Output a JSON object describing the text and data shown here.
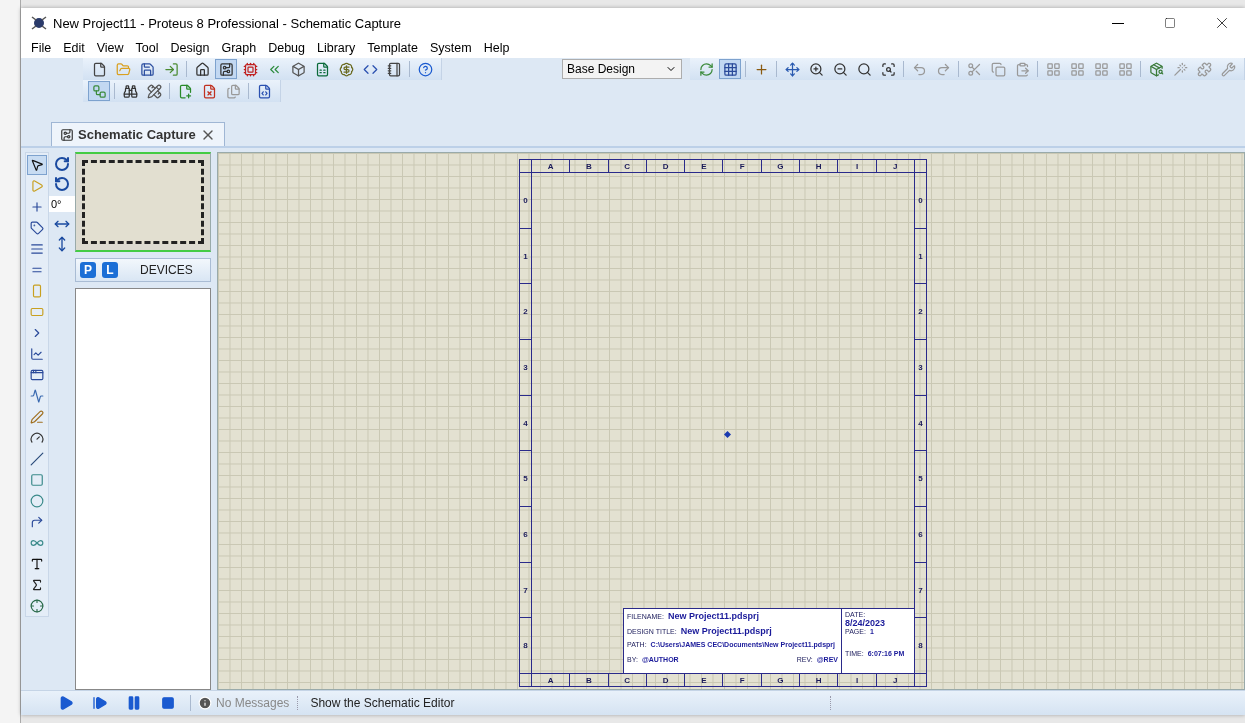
{
  "window": {
    "title": "New Project11 - Proteus 8 Professional - Schematic Capture"
  },
  "menu": [
    "File",
    "Edit",
    "View",
    "Tool",
    "Design",
    "Graph",
    "Debug",
    "Library",
    "Template",
    "System",
    "Help"
  ],
  "toolbar_main": [
    {
      "kind": "new",
      "pressed": false
    },
    {
      "kind": "open",
      "pressed": false
    },
    {
      "kind": "save",
      "pressed": false
    },
    {
      "kind": "import",
      "pressed": false
    },
    {
      "kind": "separator"
    },
    {
      "kind": "home",
      "pressed": false
    },
    {
      "kind": "schematic",
      "pressed": true
    },
    {
      "kind": "pcb",
      "pressed": false
    },
    {
      "kind": "gerber",
      "pressed": false
    },
    {
      "kind": "viewer3d",
      "pressed": false
    },
    {
      "kind": "bom",
      "pressed": false
    },
    {
      "kind": "bill",
      "pressed": false
    },
    {
      "kind": "code",
      "pressed": false
    },
    {
      "kind": "notes",
      "pressed": false
    },
    {
      "kind": "separator"
    },
    {
      "kind": "help",
      "pressed": false
    }
  ],
  "design_select": {
    "value": "Base Design"
  },
  "toolbar_view": [
    {
      "kind": "refresh",
      "pressed": false
    },
    {
      "kind": "grid",
      "pressed": true
    },
    {
      "kind": "separator"
    },
    {
      "kind": "origin",
      "pressed": false
    },
    {
      "kind": "separator"
    },
    {
      "kind": "pan",
      "pressed": false
    },
    {
      "kind": "zoomin",
      "pressed": false
    },
    {
      "kind": "zoomout",
      "pressed": false
    },
    {
      "kind": "zoomall",
      "pressed": false
    },
    {
      "kind": "zoomarea",
      "pressed": false
    },
    {
      "kind": "separator"
    },
    {
      "kind": "undo",
      "pressed": false
    },
    {
      "kind": "redo",
      "pressed": false
    },
    {
      "kind": "separator"
    },
    {
      "kind": "cut",
      "pressed": false
    },
    {
      "kind": "copy",
      "pressed": false
    },
    {
      "kind": "paste",
      "pressed": false
    },
    {
      "kind": "separator"
    },
    {
      "kind": "block",
      "pressed": false
    },
    {
      "kind": "block",
      "pressed": false
    },
    {
      "kind": "block",
      "pressed": false
    },
    {
      "kind": "block",
      "pressed": false
    },
    {
      "kind": "separator"
    },
    {
      "kind": "pick",
      "pressed": false
    },
    {
      "kind": "make",
      "pressed": false
    },
    {
      "kind": "package",
      "pressed": false
    },
    {
      "kind": "decompose",
      "pressed": false
    }
  ],
  "toolbar_design": [
    {
      "kind": "schematic2",
      "pressed": true
    },
    {
      "kind": "separator"
    },
    {
      "kind": "search",
      "pressed": false
    },
    {
      "kind": "property",
      "pressed": false
    },
    {
      "kind": "separator"
    },
    {
      "kind": "newsheet",
      "pressed": false
    },
    {
      "kind": "removesheet",
      "pressed": false
    },
    {
      "kind": "gotosheet",
      "pressed": false
    },
    {
      "kind": "separator"
    },
    {
      "kind": "netlist",
      "pressed": false
    }
  ],
  "tabs": [
    {
      "label": "Schematic Capture",
      "selected": true
    }
  ],
  "tools": [
    {
      "kind": "select",
      "selected": true
    },
    {
      "kind": "component",
      "selected": false
    },
    {
      "kind": "junction",
      "selected": false
    },
    {
      "kind": "label",
      "selected": false
    },
    {
      "kind": "script",
      "selected": false
    },
    {
      "kind": "bus",
      "selected": false
    },
    {
      "kind": "subcircuit",
      "selected": false
    },
    {
      "kind": "terminal",
      "selected": false
    },
    {
      "kind": "pin",
      "selected": false
    },
    {
      "kind": "graph",
      "selected": false
    },
    {
      "kind": "tape",
      "selected": false
    },
    {
      "kind": "generator",
      "selected": false
    },
    {
      "kind": "probe",
      "selected": false
    },
    {
      "kind": "instrument",
      "selected": false
    },
    {
      "kind": "line",
      "selected": false
    },
    {
      "kind": "box",
      "selected": false
    },
    {
      "kind": "circle",
      "selected": false
    },
    {
      "kind": "arc",
      "selected": false
    },
    {
      "kind": "path",
      "selected": false
    },
    {
      "kind": "text",
      "selected": false
    },
    {
      "kind": "symbol",
      "selected": false
    },
    {
      "kind": "marker",
      "selected": false
    }
  ],
  "rotation": {
    "angle": "0°"
  },
  "devices_panel": {
    "buttons": [
      "P",
      "L"
    ],
    "title": "DEVICES"
  },
  "sheet": {
    "top_columns": [
      "A",
      "B",
      "C",
      "D",
      "E",
      "F",
      "G",
      "H",
      "I",
      "J"
    ],
    "bottom_columns": [
      "A",
      "B",
      "C",
      "D",
      "E",
      "F",
      "G",
      "H",
      "I",
      "J"
    ],
    "left_rows": [
      "0",
      "1",
      "2",
      "3",
      "4",
      "5",
      "6",
      "7",
      "8"
    ],
    "right_rows": [
      "0",
      "1",
      "2",
      "3",
      "4",
      "5",
      "6",
      "7",
      "8"
    ],
    "title_block": {
      "filename_label": "FILENAME:",
      "filename": "New Project11.pdsprj",
      "title_label": "DESIGN TITLE:",
      "title": "New Project11.pdsprj",
      "path_label": "PATH:",
      "path": "C:\\Users\\JAMES CEC\\Documents\\New Project11.pdsprj",
      "by_label": "BY:",
      "by": "@AUTHOR",
      "rev_label": "REV:",
      "rev": "@REV",
      "date_label": "DATE:",
      "date": "8/24/2023",
      "page_label": "PAGE:",
      "page": "1",
      "time_label": "TIME:",
      "time": "6:07:16 PM"
    }
  },
  "status_bar": {
    "messages": "No Messages",
    "hint": "Show the Schematic Editor"
  }
}
